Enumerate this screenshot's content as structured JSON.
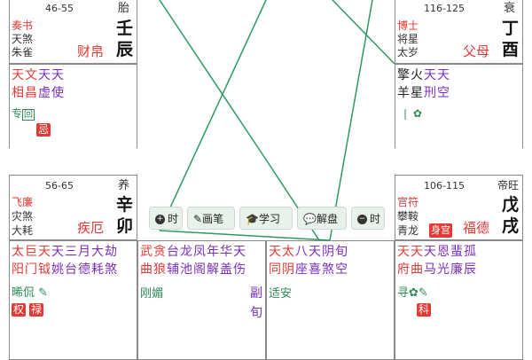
{
  "colors": {
    "red": "#e53935",
    "green": "#2e8b57",
    "purple": "#7b2fbe",
    "line": "#2e9a5e"
  },
  "c1": {
    "age": "46-55",
    "state": "胎",
    "left": [
      "奏书",
      "天煞",
      "朱雀"
    ],
    "gong": "财帛",
    "gan": "壬",
    "zhi": "辰"
  },
  "c2": {
    "age": "116-125",
    "state": "衰",
    "left": [
      "博士",
      "将星",
      "太岁"
    ],
    "gong": "父母",
    "gan": "丁",
    "zhi": "酉"
  },
  "c3": {
    "row1": "天文天天",
    "row2": "相昌虚使",
    "tag": "专",
    "tagbox": "回",
    "badge": "忌"
  },
  "c4": {
    "row1": "擎火天天",
    "row2": "羊星刑空",
    "icons": "❘ ✿"
  },
  "c5": {
    "age": "56-65",
    "state": "养",
    "left": [
      "飞廉",
      "灾煞",
      "大耗"
    ],
    "gong": "疾厄",
    "gan": "辛",
    "zhi": "卯"
  },
  "c6": {
    "age": "106-115",
    "state": "帝旺",
    "left": [
      "官符",
      "攀鞍",
      "青龙"
    ],
    "badge": "身宫",
    "gong": "福德",
    "gan": "戊",
    "zhi": "戌"
  },
  "toolbar": {
    "b1": "时",
    "b2": "画笔",
    "b3": "学习",
    "b4": "解盘",
    "b5": "时"
  },
  "b1": {
    "a1": "太",
    "a2": "巨",
    "a3": "天",
    "b1": "阳",
    "b2": "门",
    "b3": "钺",
    "rest_top": "天三月大劫",
    "rest_bot": "姚台德耗煞",
    "sub": "晞侃",
    "badges": [
      "权",
      "禄"
    ]
  },
  "b2": {
    "row1": "武贪台龙凤年华天",
    "row2": "曲狼辅池阁解盖伤",
    "row3": "刚媚",
    "extra": [
      "副",
      "旬"
    ]
  },
  "b3": {
    "row1": "天太八天阴旬",
    "row2": "同阴座喜煞空",
    "row3": "适安"
  },
  "b4": {
    "row1": "天天天恩蜚孤",
    "row2": "府曲马光廉辰",
    "sub": "寻",
    "badge": "科"
  }
}
